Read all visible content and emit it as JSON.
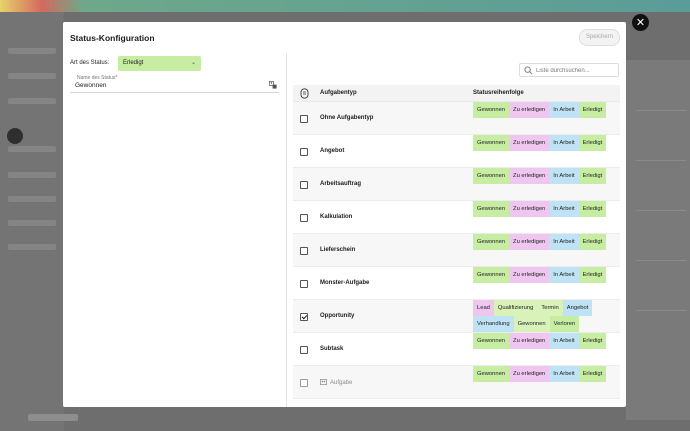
{
  "modal": {
    "title": "Status-Konfiguration",
    "save_label": "Speichern",
    "close_symbol": "✕"
  },
  "form": {
    "status_type_label": "Art des Status:",
    "status_type_value": "Erledigt",
    "status_name_label": "Name des Status",
    "status_name_required": "*",
    "status_name_value": "Gewonnen"
  },
  "search": {
    "placeholder": "Liste durchsuchen..."
  },
  "table": {
    "col_type": "Aufgabentyp",
    "col_sequence": "Statusreihenfolge",
    "rows": [
      {
        "name": "Ohne Aufgabentyp",
        "checked": false,
        "disabled": false,
        "statuses": [
          {
            "label": "Gewonnen",
            "color": "green"
          },
          {
            "label": "Zu erledigen",
            "color": "pink"
          },
          {
            "label": "In Arbeit",
            "color": "blue"
          },
          {
            "label": "Erledigt",
            "color": "green"
          }
        ]
      },
      {
        "name": "Angebot",
        "checked": false,
        "disabled": false,
        "statuses": [
          {
            "label": "Gewonnen",
            "color": "green"
          },
          {
            "label": "Zu erledigen",
            "color": "pink"
          },
          {
            "label": "In Arbeit",
            "color": "blue"
          },
          {
            "label": "Erledigt",
            "color": "green"
          }
        ]
      },
      {
        "name": "Arbeitsauftrag",
        "checked": false,
        "disabled": false,
        "statuses": [
          {
            "label": "Gewonnen",
            "color": "green"
          },
          {
            "label": "Zu erledigen",
            "color": "pink"
          },
          {
            "label": "In Arbeit",
            "color": "blue"
          },
          {
            "label": "Erledigt",
            "color": "green"
          }
        ]
      },
      {
        "name": "Kalkulation",
        "checked": false,
        "disabled": false,
        "statuses": [
          {
            "label": "Gewonnen",
            "color": "green"
          },
          {
            "label": "Zu erledigen",
            "color": "pink"
          },
          {
            "label": "In Arbeit",
            "color": "blue"
          },
          {
            "label": "Erledigt",
            "color": "green"
          }
        ]
      },
      {
        "name": "Lieferschein",
        "checked": false,
        "disabled": false,
        "statuses": [
          {
            "label": "Gewonnen",
            "color": "green"
          },
          {
            "label": "Zu erledigen",
            "color": "pink"
          },
          {
            "label": "In Arbeit",
            "color": "blue"
          },
          {
            "label": "Erledigt",
            "color": "green"
          }
        ]
      },
      {
        "name": "Monster-Aufgabe",
        "checked": false,
        "disabled": false,
        "statuses": [
          {
            "label": "Gewonnen",
            "color": "green"
          },
          {
            "label": "Zu erledigen",
            "color": "pink"
          },
          {
            "label": "In Arbeit",
            "color": "blue"
          },
          {
            "label": "Erledigt",
            "color": "green"
          }
        ]
      },
      {
        "name": "Opportunity",
        "checked": true,
        "disabled": false,
        "statuses": [
          {
            "label": "Lead",
            "color": "pink"
          },
          {
            "label": "Qualifizierung",
            "color": "greenlight"
          },
          {
            "label": "Termin",
            "color": "greenlight"
          },
          {
            "label": "Angebot",
            "color": "blue"
          },
          {
            "label": "Verhandlung",
            "color": "blue"
          },
          {
            "label": "Gewonnen",
            "color": "greenlight"
          },
          {
            "label": "Verloren",
            "color": "green"
          }
        ]
      },
      {
        "name": "Subtask",
        "checked": false,
        "disabled": false,
        "statuses": [
          {
            "label": "Gewonnen",
            "color": "green"
          },
          {
            "label": "Zu erledigen",
            "color": "pink"
          },
          {
            "label": "In Arbeit",
            "color": "blue"
          },
          {
            "label": "Erledigt",
            "color": "green"
          }
        ]
      },
      {
        "name": "Aufgabe",
        "checked": false,
        "disabled": true,
        "statuses": [
          {
            "label": "Gewonnen",
            "color": "green"
          },
          {
            "label": "Zu erledigen",
            "color": "pink"
          },
          {
            "label": "In Arbeit",
            "color": "blue"
          },
          {
            "label": "Erledigt",
            "color": "green"
          }
        ]
      }
    ]
  },
  "colors": {
    "green": "#c7eda2",
    "pink": "#eec6ef",
    "blue": "#bfe3f4",
    "overlay": "#6e6e6e"
  }
}
